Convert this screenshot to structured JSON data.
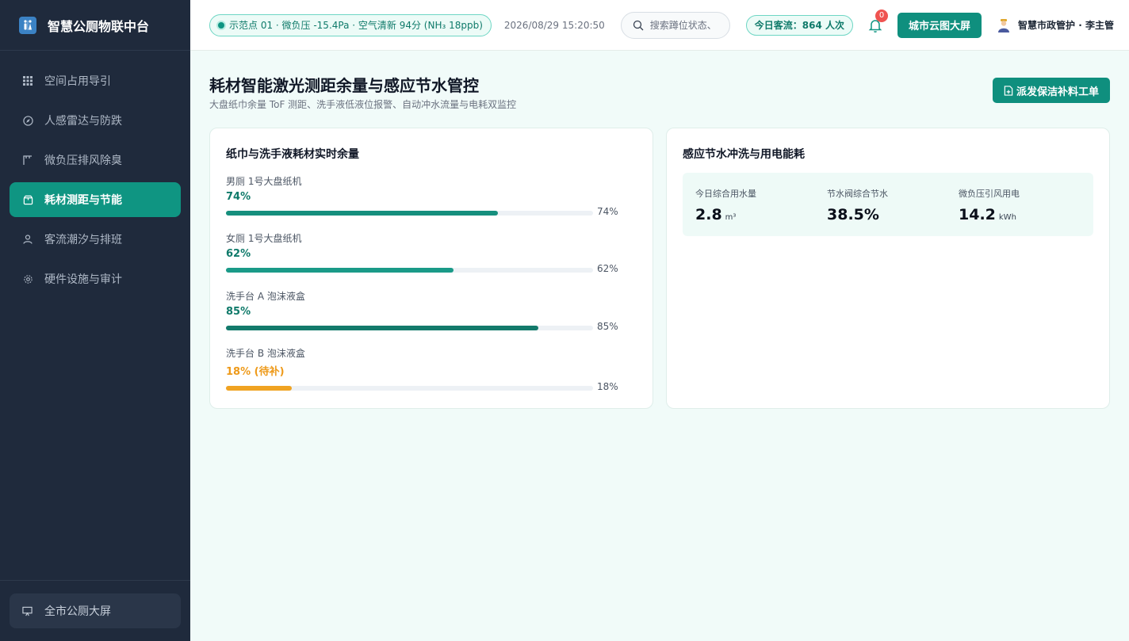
{
  "app": {
    "title": "智慧公厕物联中台",
    "logo_icon": "restroom-icon"
  },
  "sidebar": {
    "items": [
      {
        "label": "空间占用导引",
        "icon": "grid-icon",
        "active": false
      },
      {
        "label": "人感雷达与防跌",
        "icon": "compass-icon",
        "active": false
      },
      {
        "label": "微负压排风除臭",
        "icon": "fan-icon",
        "active": false
      },
      {
        "label": "耗材测距与节能",
        "icon": "package-icon",
        "active": true
      },
      {
        "label": "客流潮汐与排班",
        "icon": "user-icon",
        "active": false
      },
      {
        "label": "硬件设施与审计",
        "icon": "gear-icon",
        "active": false
      }
    ],
    "bottom": {
      "label": "全市公厕大屏",
      "icon": "screen-icon"
    }
  },
  "header": {
    "status_text": "示范点 01 · 微负压 -15.4Pa · 空气清新 94分 (NH₃ 18ppb)",
    "datetime": "2026/08/29 15:20:50",
    "search_placeholder": "搜索蹲位状态、",
    "traffic": "今日客流：864 人次",
    "notification_count": "0",
    "bigscreen_label": "城市云图大屏",
    "user_name": "智慧市政管护 · 李主管"
  },
  "page": {
    "title": "耗材智能激光测距余量与感应节水管控",
    "subtitle": "大盘纸巾余量 ToF 测距、洗手液低液位报警、自动冲水流量与电耗双监控",
    "dispatch_label": "派发保洁补料工单"
  },
  "consumables": {
    "title": "纸巾与洗手液耗材实时余量",
    "items": [
      {
        "name": "男厕 1号大盘纸机",
        "value_text": "74%",
        "pct_text": "74%",
        "level": 0.74,
        "status": "ok",
        "color": "#168f7d"
      },
      {
        "name": "女厕 1号大盘纸机",
        "value_text": "62%",
        "pct_text": "62%",
        "level": 0.62,
        "status": "ok",
        "color": "#1a9a88"
      },
      {
        "name": "洗手台 A 泡沫液盒",
        "value_text": "85%",
        "pct_text": "85%",
        "level": 0.85,
        "status": "ok",
        "color": "#137a6b"
      },
      {
        "name": "洗手台 B 泡沫液盒",
        "value_text": "18% (待补)",
        "pct_text": "18%",
        "level": 0.18,
        "status": "warn",
        "color": "#f0a322"
      }
    ]
  },
  "energy": {
    "title": "感应节水冲洗与用电能耗",
    "metrics": [
      {
        "label": "今日综合用水量",
        "value": "2.8",
        "unit": "m³"
      },
      {
        "label": "节水阀综合节水",
        "value": "38.5%",
        "unit": ""
      },
      {
        "label": "微负压引风用电",
        "value": "14.2",
        "unit": "kWh"
      }
    ]
  },
  "colors": {
    "accent": "#0f9582",
    "sidebar_bg": "#1f2a3c",
    "warn": "#f0a322",
    "badge": "#ef5350"
  }
}
